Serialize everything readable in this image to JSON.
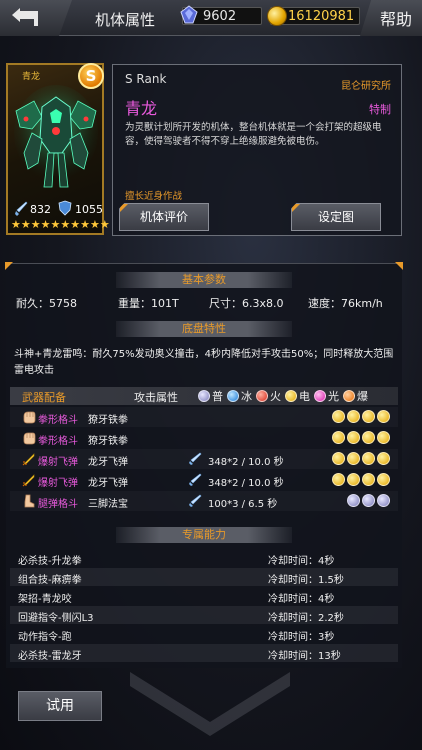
{
  "header": {
    "title": "机体属性",
    "gems": "9602",
    "coins": "16120981",
    "help_label": "帮助"
  },
  "unit": {
    "portrait_name": "青龙",
    "grade_badge": "S",
    "attack": "832",
    "defense": "1055",
    "stars": 10,
    "rank": "S Rank",
    "lab": "昆仑研究所",
    "name": "青龙",
    "special_tag": "特制",
    "description": "为灵獸计划所开发的机体，整台机体就是一个会打架的超级电容，使得驾驶者不得不穿上绝缘服避免被电伤。",
    "specialty": "擅长近身作战",
    "eval_button": "机体评价",
    "design_button": "设定图"
  },
  "basic": {
    "heading": "基本参数",
    "durability": "耐久：5758",
    "weight": "重量：101T",
    "size": "尺寸：6.3x8.0",
    "speed": "速度：76km/h"
  },
  "chassis": {
    "heading": "底盘特性",
    "text": "斗神+青龙雷鸣：耐久75%发动奥义撞击，4秒内降低对手攻击50%；同时释放大范围雷电攻击"
  },
  "weapons": {
    "heading": "武器配备",
    "attr_label": "攻击属性",
    "legend": [
      {
        "label": "普",
        "icon": "normal-element-icon",
        "color": "#7a7ab8"
      },
      {
        "label": "冰",
        "icon": "ice-element-icon",
        "color": "#1a7ad8"
      },
      {
        "label": "火",
        "icon": "fire-element-icon",
        "color": "#d82a1a"
      },
      {
        "label": "电",
        "icon": "electric-element-icon",
        "color": "#e3a500"
      },
      {
        "label": "光",
        "icon": "light-element-icon",
        "color": "#d81aa8"
      },
      {
        "label": "爆",
        "icon": "burst-element-icon",
        "color": "#e86a00"
      }
    ],
    "rows": [
      {
        "type": "拳形格斗",
        "name": "獠牙铁拳",
        "stat": "",
        "element": "electric",
        "count": 4
      },
      {
        "type": "拳形格斗",
        "name": "獠牙铁拳",
        "stat": "",
        "element": "electric",
        "count": 4
      },
      {
        "type": "爆射飞弹",
        "name": "龙牙飞弹",
        "stat": "348*2 / 10.0 秒",
        "element": "electric",
        "count": 4
      },
      {
        "type": "爆射飞弹",
        "name": "龙牙飞弹",
        "stat": "348*2 / 10.0 秒",
        "element": "electric",
        "count": 4
      },
      {
        "type": "腿弹格斗",
        "name": "三脚法宝",
        "stat": "100*3 / 6.5 秒",
        "element": "normal",
        "count": 3
      }
    ]
  },
  "abilities": {
    "heading": "专属能力",
    "rows": [
      {
        "name": "必杀技-升龙拳",
        "cooldown": "冷却时间：4秒"
      },
      {
        "name": "组合技-麻痹拳",
        "cooldown": "冷却时间：1.5秒"
      },
      {
        "name": "架招-青龙咬",
        "cooldown": "冷却时间：4秒"
      },
      {
        "name": "回避指令-侧闪L3",
        "cooldown": "冷却时间：2.2秒"
      },
      {
        "name": "动作指令-跑",
        "cooldown": "冷却时间：3秒"
      },
      {
        "name": "必杀技-雷龙牙",
        "cooldown": "冷却时间：13秒"
      }
    ]
  },
  "footer": {
    "try_label": "试用"
  }
}
